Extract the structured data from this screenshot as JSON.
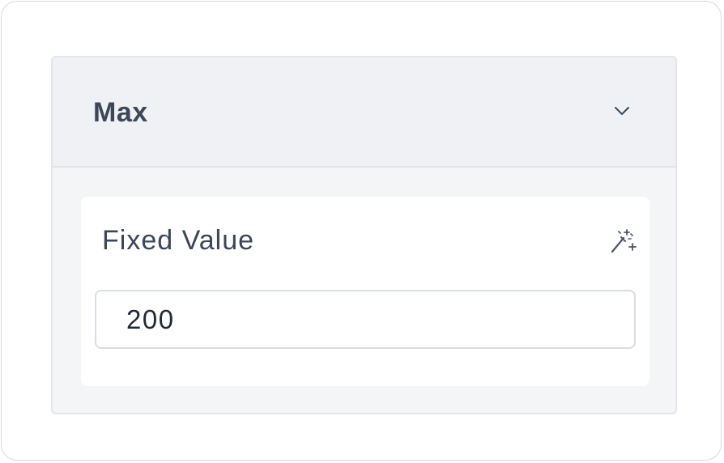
{
  "section": {
    "title": "Max",
    "expand_icon": "chevron-down-icon"
  },
  "field": {
    "label": "Fixed Value",
    "action_icon": "magic-wand-icon",
    "value": "200"
  },
  "colors": {
    "header_bg": "#eff1f4",
    "panel_bg": "#f4f5f7",
    "card_bg": "#ffffff",
    "text": "#3b4658",
    "border": "#d9dde3"
  }
}
